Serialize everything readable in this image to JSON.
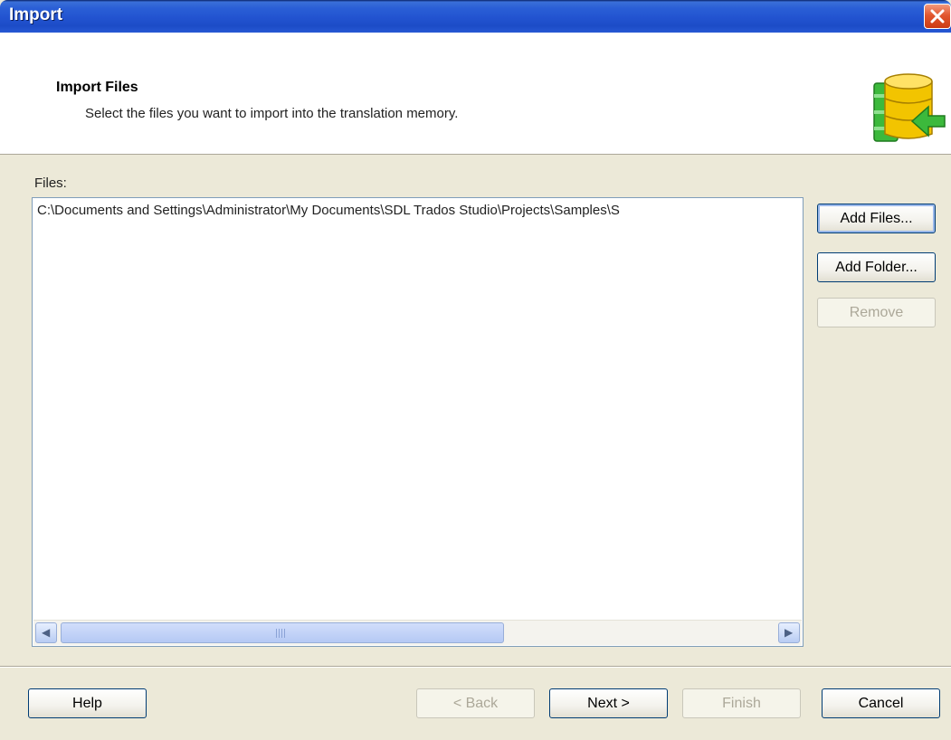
{
  "window": {
    "title": "Import"
  },
  "header": {
    "title": "Import Files",
    "subtitle": "Select the files you want to import into the translation memory.",
    "icon": "translation-memory-import-icon"
  },
  "files": {
    "label": "Files:",
    "items": [
      "C:\\Documents and Settings\\Administrator\\My Documents\\SDL Trados Studio\\Projects\\Samples\\S"
    ]
  },
  "side_buttons": {
    "add_files": "Add Files...",
    "add_folder": "Add Folder...",
    "remove": "Remove"
  },
  "footer": {
    "help": "Help",
    "back": "< Back",
    "next": "Next >",
    "finish": "Finish",
    "cancel": "Cancel"
  },
  "scrollbar": {
    "grip_glyph": "III"
  },
  "colors": {
    "title_bar": "#2253d0",
    "close_button": "#e2582f",
    "dialog_background": "#ece9d8",
    "icon_database": "#f2c400",
    "icon_arrow": "#3cb93c"
  }
}
